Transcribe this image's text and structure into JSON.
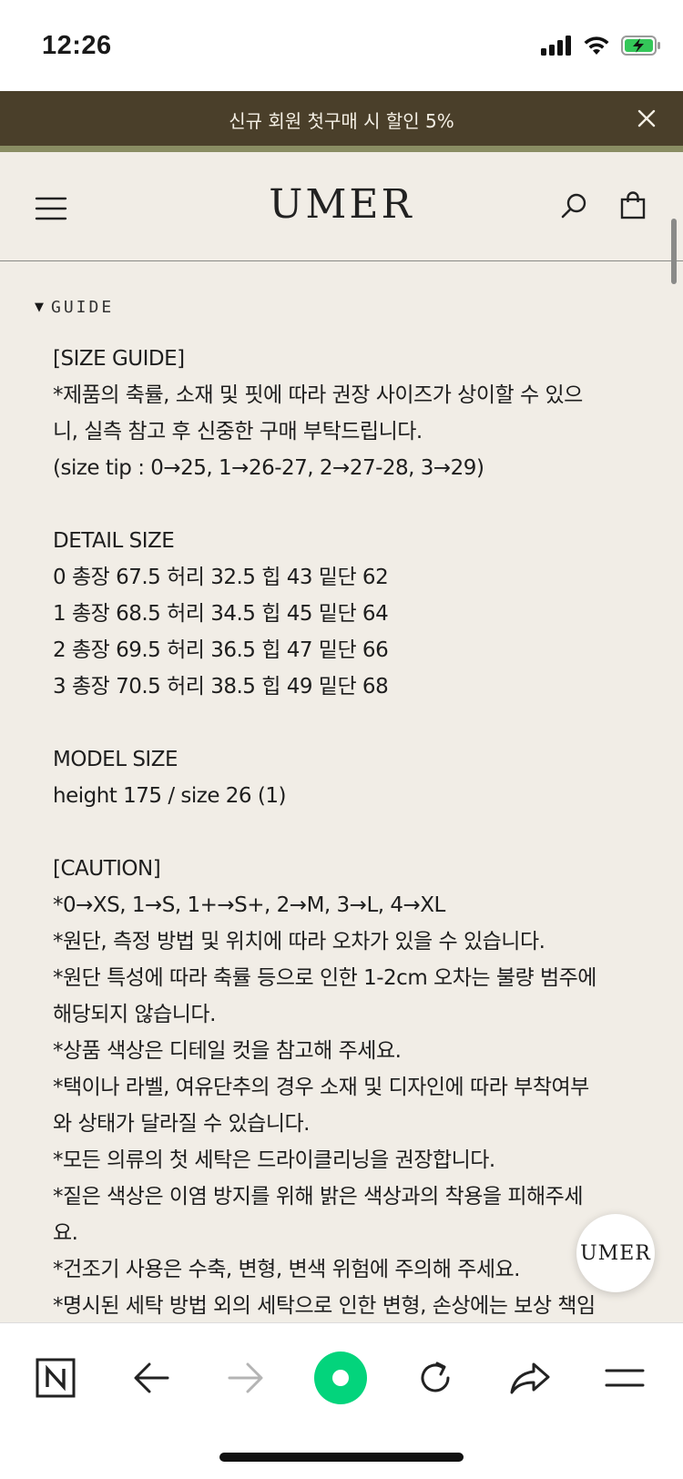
{
  "status_bar": {
    "time": "12:26"
  },
  "promo": {
    "text": "신규 회원 첫구매 시 할인 5%"
  },
  "header": {
    "logo": "UMER"
  },
  "guide": {
    "label": "GUIDE"
  },
  "content": {
    "size_guide_title": "[SIZE GUIDE]",
    "size_guide_note_1": "*제품의 축률, 소재 및 핏에 따라 권장 사이즈가 상이할 수 있으",
    "size_guide_note_2": "니, 실측 참고 후 신중한 구매 부탁드립니다.",
    "size_tip": "(size tip : 0→25, 1→26-27, 2→27-28, 3→29)",
    "detail_title": "DETAIL SIZE",
    "detail_rows": [
      "0 총장 67.5 허리 32.5 힙 43 밑단 62",
      "1 총장 68.5 허리 34.5 힙 45 밑단 64",
      "2 총장 69.5 허리 36.5 힙 47 밑단 66",
      "3 총장 70.5 허리 38.5 힙 49 밑단 68"
    ],
    "model_title": "MODEL SIZE",
    "model_info": "height 175 / size 26 (1)",
    "caution_title": "[CAUTION]",
    "caution_lines": [
      "*0→XS, 1→S, 1+→S+, 2→M, 3→L, 4→XL",
      "*원단, 측정 방법 및 위치에 따라 오차가 있을 수 있습니다.",
      "*원단 특성에 따라 축률 등으로 인한 1-2cm 오차는 불량 범주에",
      "해당되지 않습니다.",
      "*상품 색상은 디테일 컷을 참고해 주세요.",
      "*택이나 라벨, 여유단추의 경우 소재 및 디자인에 따라 부착여부",
      "와 상태가 달라질 수 있습니다.",
      "*모든 의류의 첫 세탁은 드라이클리닝을 권장합니다.",
      "*짙은 색상은 이염 방지를 위해 밝은 색상과의 착용을 피해주세",
      "요.",
      "*건조기 사용은 수축, 변형, 변색 위험에 주의해 주세요.",
      "*명시된 세탁 방법 외의 세탁으로 인한 변형, 손상에는 보상 책임"
    ]
  },
  "fab": {
    "label": "UMER"
  },
  "browser": {
    "n_label": "N"
  },
  "colors": {
    "promo_bg": "#4a3f2a",
    "promo_stripe": "#8a8d63",
    "page_bg": "#f1ede6",
    "naver_green": "#03d47c"
  }
}
